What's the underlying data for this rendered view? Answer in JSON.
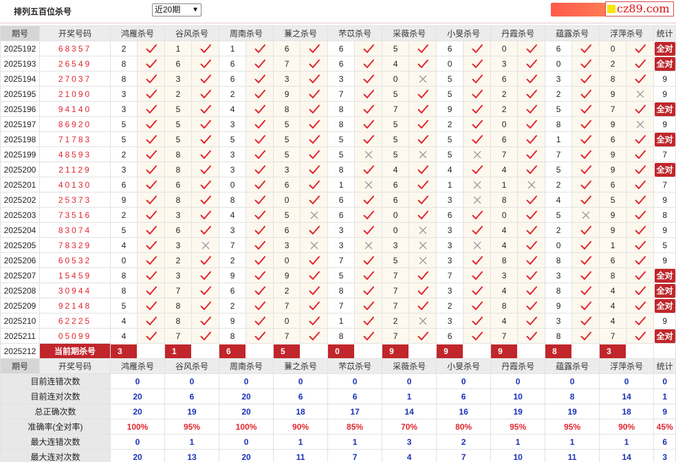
{
  "header": {
    "title": "排列五百位杀号",
    "period_select": "近20期",
    "logo_text": "cz89.com"
  },
  "columns": {
    "period": "期号",
    "code": "开奖号码",
    "experts": [
      "鸿雁杀号",
      "谷风杀号",
      "周南杀号",
      "蒹之杀号",
      "芣苡杀号",
      "采薇杀号",
      "小旻杀号",
      "丹霞杀号",
      "蕴露杀号",
      "浮萍杀号"
    ],
    "stat": "统计"
  },
  "rows": [
    {
      "period": "2025192",
      "code": "68357",
      "nums": [
        "2",
        "1",
        "1",
        "6",
        "6",
        "5",
        "6",
        "0",
        "6",
        "0"
      ],
      "ok": [
        1,
        1,
        1,
        1,
        1,
        1,
        1,
        1,
        1,
        1
      ],
      "stat": "全对"
    },
    {
      "period": "2025193",
      "code": "26549",
      "nums": [
        "8",
        "6",
        "6",
        "7",
        "6",
        "4",
        "0",
        "3",
        "0",
        "2"
      ],
      "ok": [
        1,
        1,
        1,
        1,
        1,
        1,
        1,
        1,
        1,
        1
      ],
      "stat": "全对"
    },
    {
      "period": "2025194",
      "code": "27037",
      "nums": [
        "8",
        "3",
        "6",
        "3",
        "3",
        "0",
        "5",
        "6",
        "3",
        "8"
      ],
      "ok": [
        1,
        1,
        1,
        1,
        1,
        0,
        1,
        1,
        1,
        1
      ],
      "stat": "9"
    },
    {
      "period": "2025195",
      "code": "21090",
      "nums": [
        "3",
        "2",
        "2",
        "9",
        "7",
        "5",
        "5",
        "2",
        "2",
        "9"
      ],
      "ok": [
        1,
        1,
        1,
        1,
        1,
        1,
        1,
        1,
        1,
        0
      ],
      "stat": "9"
    },
    {
      "period": "2025196",
      "code": "94140",
      "nums": [
        "3",
        "5",
        "4",
        "8",
        "8",
        "7",
        "9",
        "2",
        "5",
        "7"
      ],
      "ok": [
        1,
        1,
        1,
        1,
        1,
        1,
        1,
        1,
        1,
        1
      ],
      "stat": "全对"
    },
    {
      "period": "2025197",
      "code": "86920",
      "nums": [
        "5",
        "5",
        "3",
        "5",
        "8",
        "5",
        "2",
        "0",
        "8",
        "9"
      ],
      "ok": [
        1,
        1,
        1,
        1,
        1,
        1,
        1,
        1,
        1,
        0
      ],
      "stat": "9"
    },
    {
      "period": "2025198",
      "code": "71783",
      "nums": [
        "5",
        "5",
        "5",
        "5",
        "5",
        "5",
        "5",
        "6",
        "1",
        "6"
      ],
      "ok": [
        1,
        1,
        1,
        1,
        1,
        1,
        1,
        1,
        1,
        1
      ],
      "stat": "全对"
    },
    {
      "period": "2025199",
      "code": "48593",
      "nums": [
        "2",
        "8",
        "3",
        "5",
        "5",
        "5",
        "5",
        "7",
        "7",
        "9"
      ],
      "ok": [
        1,
        1,
        1,
        1,
        0,
        0,
        0,
        1,
        1,
        1
      ],
      "stat": "7"
    },
    {
      "period": "2025200",
      "code": "21129",
      "nums": [
        "3",
        "8",
        "3",
        "3",
        "8",
        "4",
        "4",
        "4",
        "5",
        "9"
      ],
      "ok": [
        1,
        1,
        1,
        1,
        1,
        1,
        1,
        1,
        1,
        1
      ],
      "stat": "全对"
    },
    {
      "period": "2025201",
      "code": "40130",
      "nums": [
        "6",
        "6",
        "0",
        "6",
        "1",
        "6",
        "1",
        "1",
        "2",
        "6"
      ],
      "ok": [
        1,
        1,
        1,
        1,
        0,
        1,
        0,
        0,
        1,
        1
      ],
      "stat": "7"
    },
    {
      "period": "2025202",
      "code": "25373",
      "nums": [
        "9",
        "8",
        "8",
        "0",
        "6",
        "6",
        "3",
        "8",
        "4",
        "5"
      ],
      "ok": [
        1,
        1,
        1,
        1,
        1,
        1,
        0,
        1,
        1,
        1
      ],
      "stat": "9"
    },
    {
      "period": "2025203",
      "code": "73516",
      "nums": [
        "2",
        "3",
        "4",
        "5",
        "6",
        "0",
        "6",
        "0",
        "5",
        "9"
      ],
      "ok": [
        1,
        1,
        1,
        0,
        1,
        1,
        1,
        1,
        0,
        1
      ],
      "stat": "8"
    },
    {
      "period": "2025204",
      "code": "83074",
      "nums": [
        "5",
        "6",
        "3",
        "6",
        "3",
        "0",
        "3",
        "4",
        "2",
        "9"
      ],
      "ok": [
        1,
        1,
        1,
        1,
        1,
        0,
        1,
        1,
        1,
        1
      ],
      "stat": "9"
    },
    {
      "period": "2025205",
      "code": "78329",
      "nums": [
        "4",
        "3",
        "7",
        "3",
        "3",
        "3",
        "3",
        "4",
        "0",
        "1"
      ],
      "ok": [
        1,
        0,
        1,
        0,
        0,
        0,
        0,
        1,
        1,
        1
      ],
      "stat": "5"
    },
    {
      "period": "2025206",
      "code": "60532",
      "nums": [
        "0",
        "2",
        "2",
        "0",
        "7",
        "5",
        "3",
        "8",
        "8",
        "6"
      ],
      "ok": [
        1,
        1,
        1,
        1,
        1,
        0,
        1,
        1,
        1,
        1
      ],
      "stat": "9"
    },
    {
      "period": "2025207",
      "code": "15459",
      "nums": [
        "8",
        "3",
        "9",
        "9",
        "5",
        "7",
        "7",
        "3",
        "3",
        "8"
      ],
      "ok": [
        1,
        1,
        1,
        1,
        1,
        1,
        1,
        1,
        1,
        1
      ],
      "stat": "全对"
    },
    {
      "period": "2025208",
      "code": "30944",
      "nums": [
        "8",
        "7",
        "6",
        "2",
        "8",
        "7",
        "3",
        "4",
        "8",
        "4"
      ],
      "ok": [
        1,
        1,
        1,
        1,
        1,
        1,
        1,
        1,
        1,
        1
      ],
      "stat": "全对"
    },
    {
      "period": "2025209",
      "code": "92148",
      "nums": [
        "5",
        "8",
        "2",
        "7",
        "7",
        "7",
        "2",
        "8",
        "9",
        "4"
      ],
      "ok": [
        1,
        1,
        1,
        1,
        1,
        1,
        1,
        1,
        1,
        1
      ],
      "stat": "全对"
    },
    {
      "period": "2025210",
      "code": "62225",
      "nums": [
        "4",
        "8",
        "9",
        "0",
        "1",
        "2",
        "3",
        "4",
        "3",
        "4"
      ],
      "ok": [
        1,
        1,
        1,
        1,
        1,
        0,
        1,
        1,
        1,
        1
      ],
      "stat": "9"
    },
    {
      "period": "2025211",
      "code": "05099",
      "nums": [
        "4",
        "7",
        "8",
        "7",
        "8",
        "7",
        "6",
        "7",
        "8",
        "7"
      ],
      "ok": [
        1,
        1,
        1,
        1,
        1,
        1,
        1,
        1,
        1,
        1
      ],
      "stat": "全对"
    }
  ],
  "current": {
    "period": "2025212",
    "label": "当前期杀号",
    "nums": [
      "3",
      "1",
      "6",
      "5",
      "0",
      "9",
      "9",
      "9",
      "8",
      "3"
    ]
  },
  "summary": [
    {
      "label": "目前连错次数",
      "values": [
        "0",
        "0",
        "0",
        "0",
        "0",
        "0",
        "0",
        "0",
        "0",
        "0"
      ],
      "stat": "0",
      "red": false
    },
    {
      "label": "目前连对次数",
      "values": [
        "20",
        "6",
        "20",
        "6",
        "6",
        "1",
        "6",
        "10",
        "8",
        "14"
      ],
      "stat": "1",
      "red": false
    },
    {
      "label": "总正确次数",
      "values": [
        "20",
        "19",
        "20",
        "18",
        "17",
        "14",
        "16",
        "19",
        "19",
        "18"
      ],
      "stat": "9",
      "red": false
    },
    {
      "label": "准确率(全对率)",
      "values": [
        "100%",
        "95%",
        "100%",
        "90%",
        "85%",
        "70%",
        "80%",
        "95%",
        "95%",
        "90%"
      ],
      "stat": "45%",
      "red": true
    },
    {
      "label": "最大连错次数",
      "values": [
        "0",
        "1",
        "0",
        "1",
        "1",
        "3",
        "2",
        "1",
        "1",
        "1"
      ],
      "stat": "6",
      "red": false
    },
    {
      "label": "最大连对次数",
      "values": [
        "20",
        "13",
        "20",
        "11",
        "7",
        "4",
        "7",
        "10",
        "11",
        "14"
      ],
      "stat": "3",
      "red": false
    }
  ],
  "colors": {
    "accent": "#c0262b",
    "code_red": "#e0262f",
    "tick": "#e0262f",
    "cross": "#9a9a9a",
    "summary_blue": "#1a32b8"
  },
  "icons": {
    "correct": "check-icon",
    "wrong": "cross-icon"
  }
}
